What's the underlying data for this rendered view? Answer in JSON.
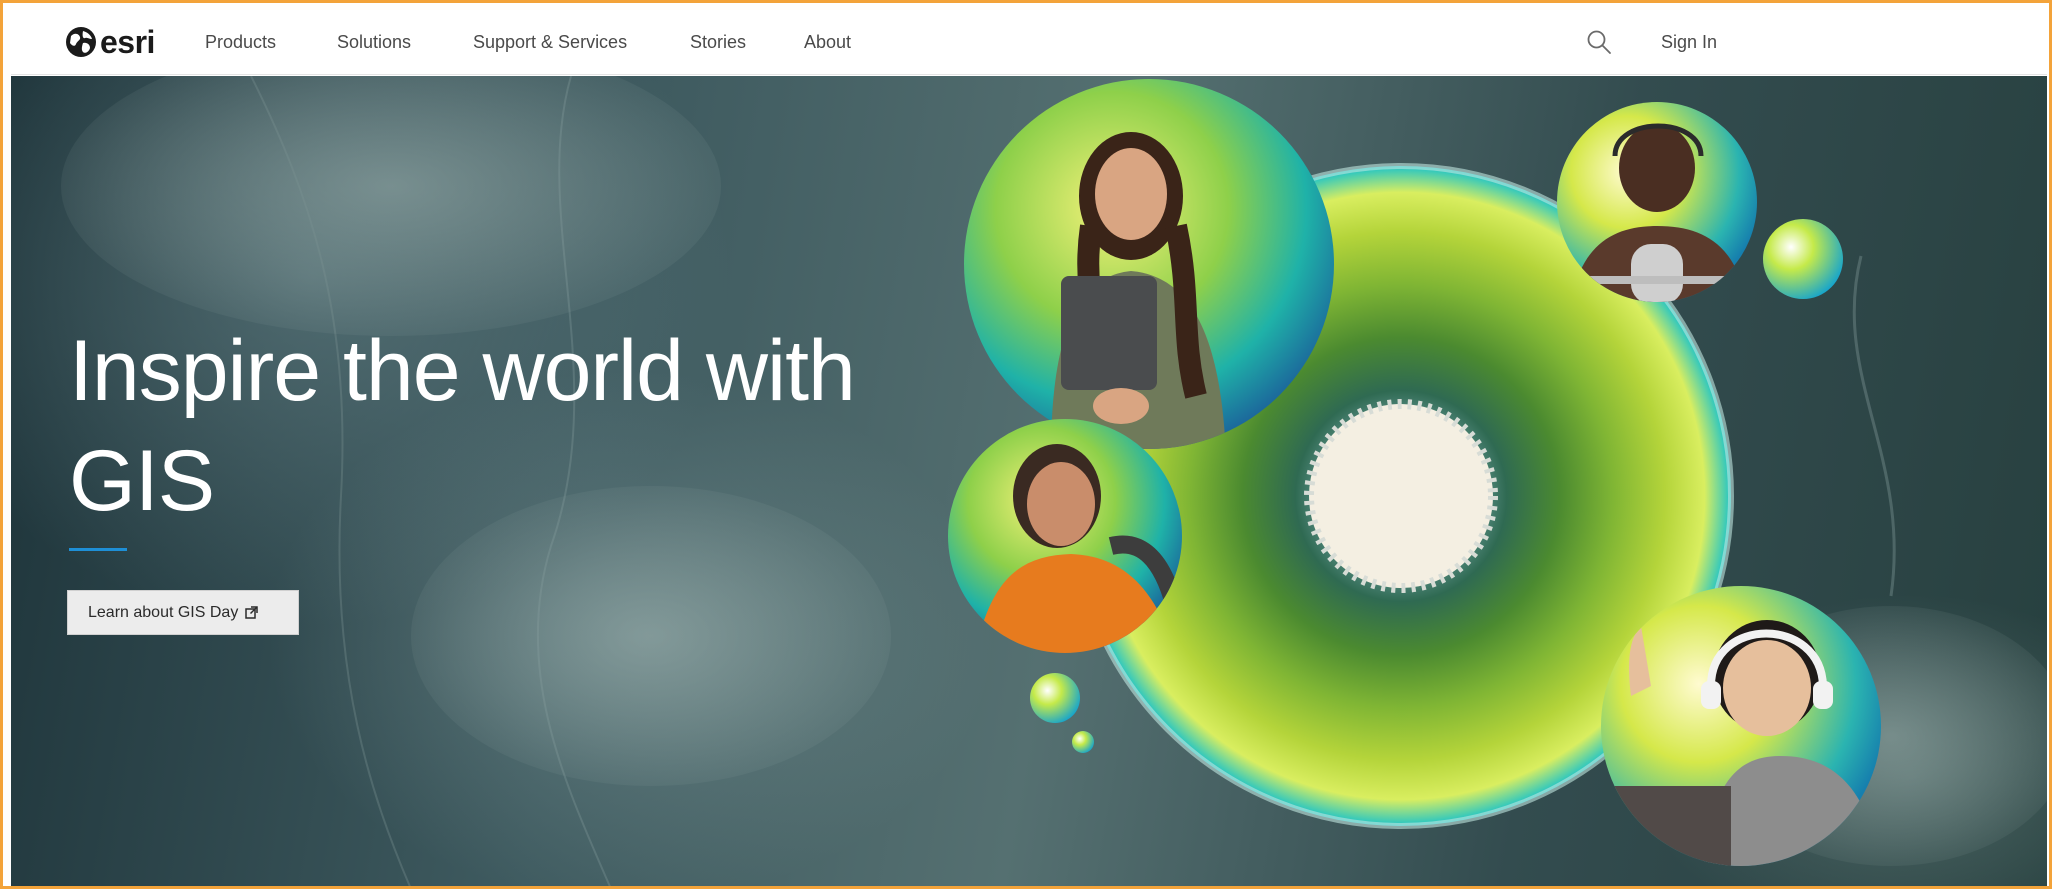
{
  "header": {
    "logo_text": "esri",
    "nav": [
      "Products",
      "Solutions",
      "Support & Services",
      "Stories",
      "About"
    ],
    "search_icon": "search-icon",
    "signin_label": "Sign In"
  },
  "hero": {
    "title": "Inspire the world with GIS",
    "cta_label": "Learn about GIS Day",
    "cta_icon": "external-link-icon"
  },
  "colors": {
    "accent": "#1e8fd6",
    "frame": "#f3a33a",
    "nav_text": "#4a4a4a",
    "cta_bg": "#ececec"
  }
}
